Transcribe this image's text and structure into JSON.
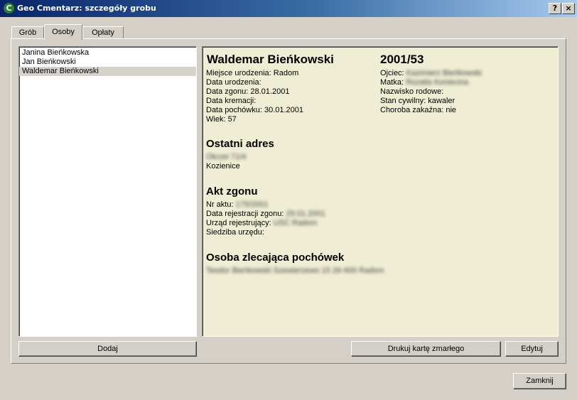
{
  "window": {
    "title": "Geo Cmentarz: szczegóły grobu",
    "app_icon": "geo-cmentarz-app-icon",
    "help_button": "?",
    "close_button": "×"
  },
  "tabs": [
    {
      "label": "Grób",
      "selected": false
    },
    {
      "label": "Osoby",
      "selected": true
    },
    {
      "label": "Opłaty",
      "selected": false
    }
  ],
  "persons": [
    {
      "name": "Janina Bieńkowska",
      "selected": false
    },
    {
      "name": "Jan Bieńkowski",
      "selected": false
    },
    {
      "name": "Waldemar Bieńkowski",
      "selected": true
    }
  ],
  "details": {
    "name": "Waldemar Bieńkowski",
    "grave_number": "2001/53",
    "left_fields": [
      {
        "label": "Miejsce urodzenia:",
        "value": "Radom",
        "redacted": false
      },
      {
        "label": "Data urodzenia:",
        "value": "",
        "redacted": false
      },
      {
        "label": "Data zgonu:",
        "value": "28.01.2001",
        "redacted": false
      },
      {
        "label": "Data kremacji:",
        "value": "",
        "redacted": false
      },
      {
        "label": "Data pochówku:",
        "value": "30.01.2001",
        "redacted": false
      },
      {
        "label": "Wiek:",
        "value": "57",
        "redacted": false
      }
    ],
    "right_fields": [
      {
        "label": "Ojciec:",
        "value": "Kazimierz Bieńkowski",
        "redacted": true
      },
      {
        "label": "Matka:",
        "value": "Rozalia Koniecina",
        "redacted": true
      },
      {
        "label": "Nazwisko rodowe:",
        "value": "",
        "redacted": false
      },
      {
        "label": "Stan cywilny:",
        "value": "kawaler",
        "redacted": false
      },
      {
        "label": "Choroba zakaźna:",
        "value": "nie",
        "redacted": false
      }
    ],
    "address": {
      "heading": "Ostatni adres",
      "street": "Okrzei 71/4",
      "city": "Kozienice"
    },
    "death_act": {
      "heading": "Akt zgonu",
      "fields": [
        {
          "label": "Nr aktu:",
          "value": "175/2001",
          "redacted": true
        },
        {
          "label": "Data rejestracji zgonu:",
          "value": "29.01.2001",
          "redacted": true
        },
        {
          "label": "Urząd rejestrujący:",
          "value": "USC Radom",
          "redacted": true
        },
        {
          "label": "Siedziba urzędu:",
          "value": "",
          "redacted": false
        }
      ]
    },
    "commissioner": {
      "heading": "Osoba zlecająca pochówek",
      "name": "Teodor Bieńkowski",
      "street": "Szewierzewo 15",
      "city": "26-600 Radom"
    }
  },
  "buttons": {
    "add": "Dodaj",
    "print": "Drukuj kartę zmarłego",
    "edit": "Edytuj",
    "close": "Zamknij"
  }
}
